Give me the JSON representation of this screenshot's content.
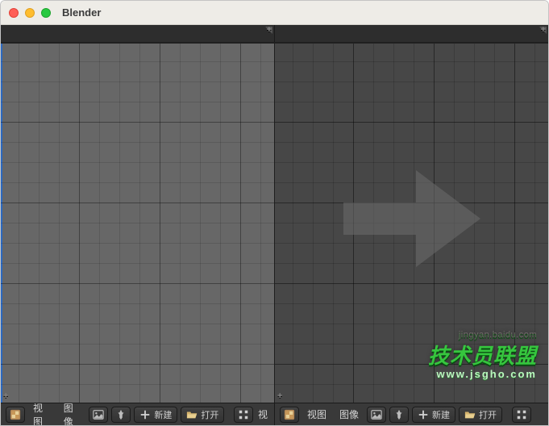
{
  "window": {
    "title": "Blender"
  },
  "panes": {
    "left": {
      "view_menu": "视图",
      "image_menu": "图像",
      "new_label": "新建",
      "open_label": "打开"
    },
    "right": {
      "view_menu": "视图",
      "image_menu_partial": "图像",
      "new_label": "新建",
      "open_label": "打开"
    }
  },
  "watermark": {
    "faded_host": "jingyan.baidu.com",
    "brand_cn": "技术员联盟",
    "brand_url": "www.jsgho.com"
  },
  "icons": {
    "editor_type": "uv-image-editor-icon",
    "pin": "pin-icon",
    "add": "plus-icon",
    "open": "folder-open-icon"
  },
  "colors": {
    "titlebar": "#eeece7",
    "dark_strip": "#2d2d2d",
    "left_canvas": "#676767",
    "right_canvas": "#474747",
    "toolbar_bg": "#393939",
    "accent_blue": "#2669c9",
    "watermark_green": "#36c63e"
  }
}
